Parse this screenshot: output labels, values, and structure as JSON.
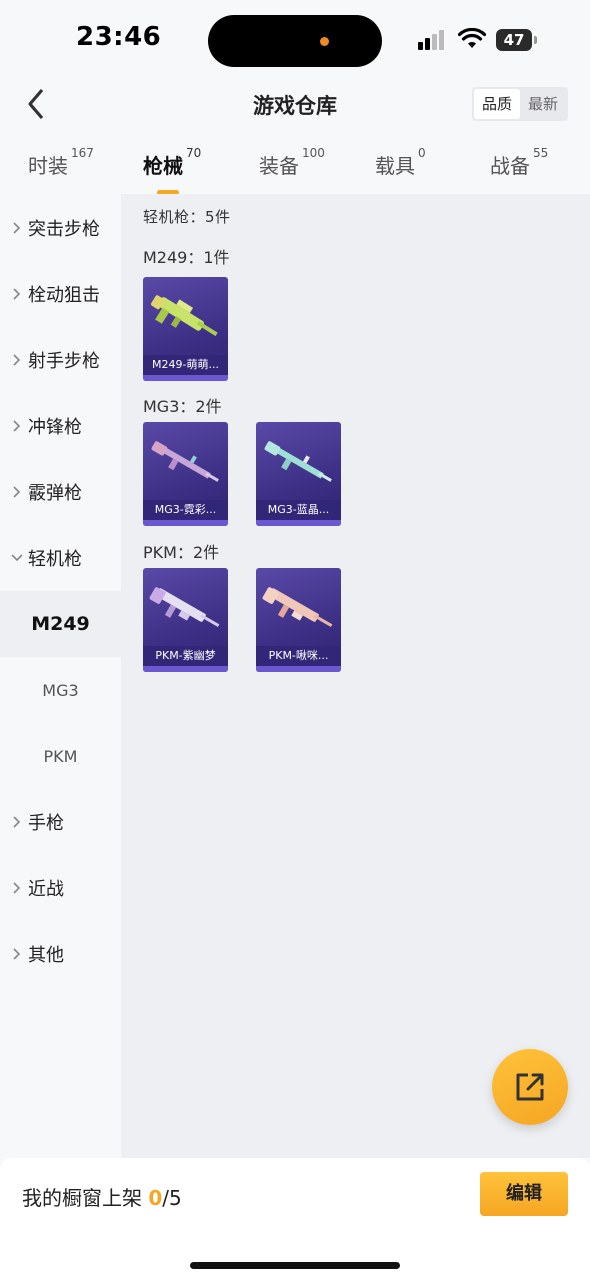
{
  "status": {
    "time": "23:46",
    "battery": "47"
  },
  "header": {
    "title": "游戏仓库",
    "sort": [
      "品质",
      "最新"
    ]
  },
  "tabs": [
    {
      "label": "时装",
      "count": "167"
    },
    {
      "label": "枪械",
      "count": "70"
    },
    {
      "label": "装备",
      "count": "100"
    },
    {
      "label": "载具",
      "count": "0"
    },
    {
      "label": "战备",
      "count": "55"
    }
  ],
  "sidebar": {
    "items": [
      "突击步枪",
      "栓动狙击",
      "射手步枪",
      "冲锋枪",
      "霰弹枪",
      "轻机枪"
    ],
    "subs": [
      "M249",
      "MG3",
      "PKM"
    ],
    "items_after": [
      "手枪",
      "近战",
      "其他"
    ]
  },
  "main": {
    "section_title": "轻机枪：5件",
    "groups": [
      {
        "title": "M249：1件",
        "cards": [
          "M249-萌萌..."
        ]
      },
      {
        "title": "MG3：2件",
        "cards": [
          "MG3-霓彩...",
          "MG3-蓝晶..."
        ]
      },
      {
        "title": "PKM：2件",
        "cards": [
          "PKM-紫幽梦",
          "PKM-啾咪..."
        ]
      }
    ]
  },
  "footer": {
    "showcase_label": "我的橱窗上架",
    "showcase_current": "0",
    "showcase_total": "/5",
    "edit_label": "编辑"
  },
  "colors": {
    "accent": "#f5a623",
    "card_bg": "#3d2f85"
  },
  "icons": [
    "back-icon",
    "share-icon",
    "chevron-right-icon",
    "chevron-down-icon"
  ]
}
